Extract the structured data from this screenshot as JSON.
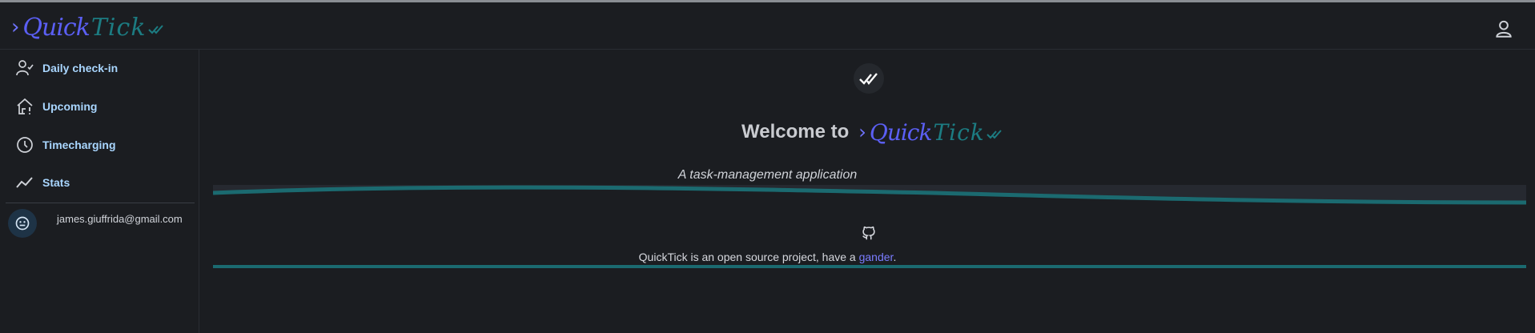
{
  "brand": {
    "chevron": "›",
    "part1": "Quick",
    "part2": "Tick",
    "colors": {
      "quick": "#5b5ff4",
      "tick": "#1c7c82"
    }
  },
  "header": {
    "user_icon": "user-icon"
  },
  "sidebar": {
    "items": [
      {
        "label": "Daily check-in",
        "icon": "user-check-icon"
      },
      {
        "label": "Upcoming",
        "icon": "home-alert-icon"
      },
      {
        "label": "Timecharging",
        "icon": "clock-icon"
      },
      {
        "label": "Stats",
        "icon": "trend-icon"
      }
    ],
    "account": {
      "email": "james.giuffrida@gmail.com",
      "avatar_icon": "smiley-icon"
    }
  },
  "main": {
    "welcome_prefix": "Welcome to",
    "tagline": "A task-management application",
    "oss_prefix": "QuickTick is an open source project, have a ",
    "oss_link": "gander",
    "oss_suffix": "."
  },
  "colors": {
    "background": "#1b1d21",
    "nav_label": "#a9d6ff",
    "accent_wave": "#1b6a70",
    "link": "#7a7cff"
  }
}
